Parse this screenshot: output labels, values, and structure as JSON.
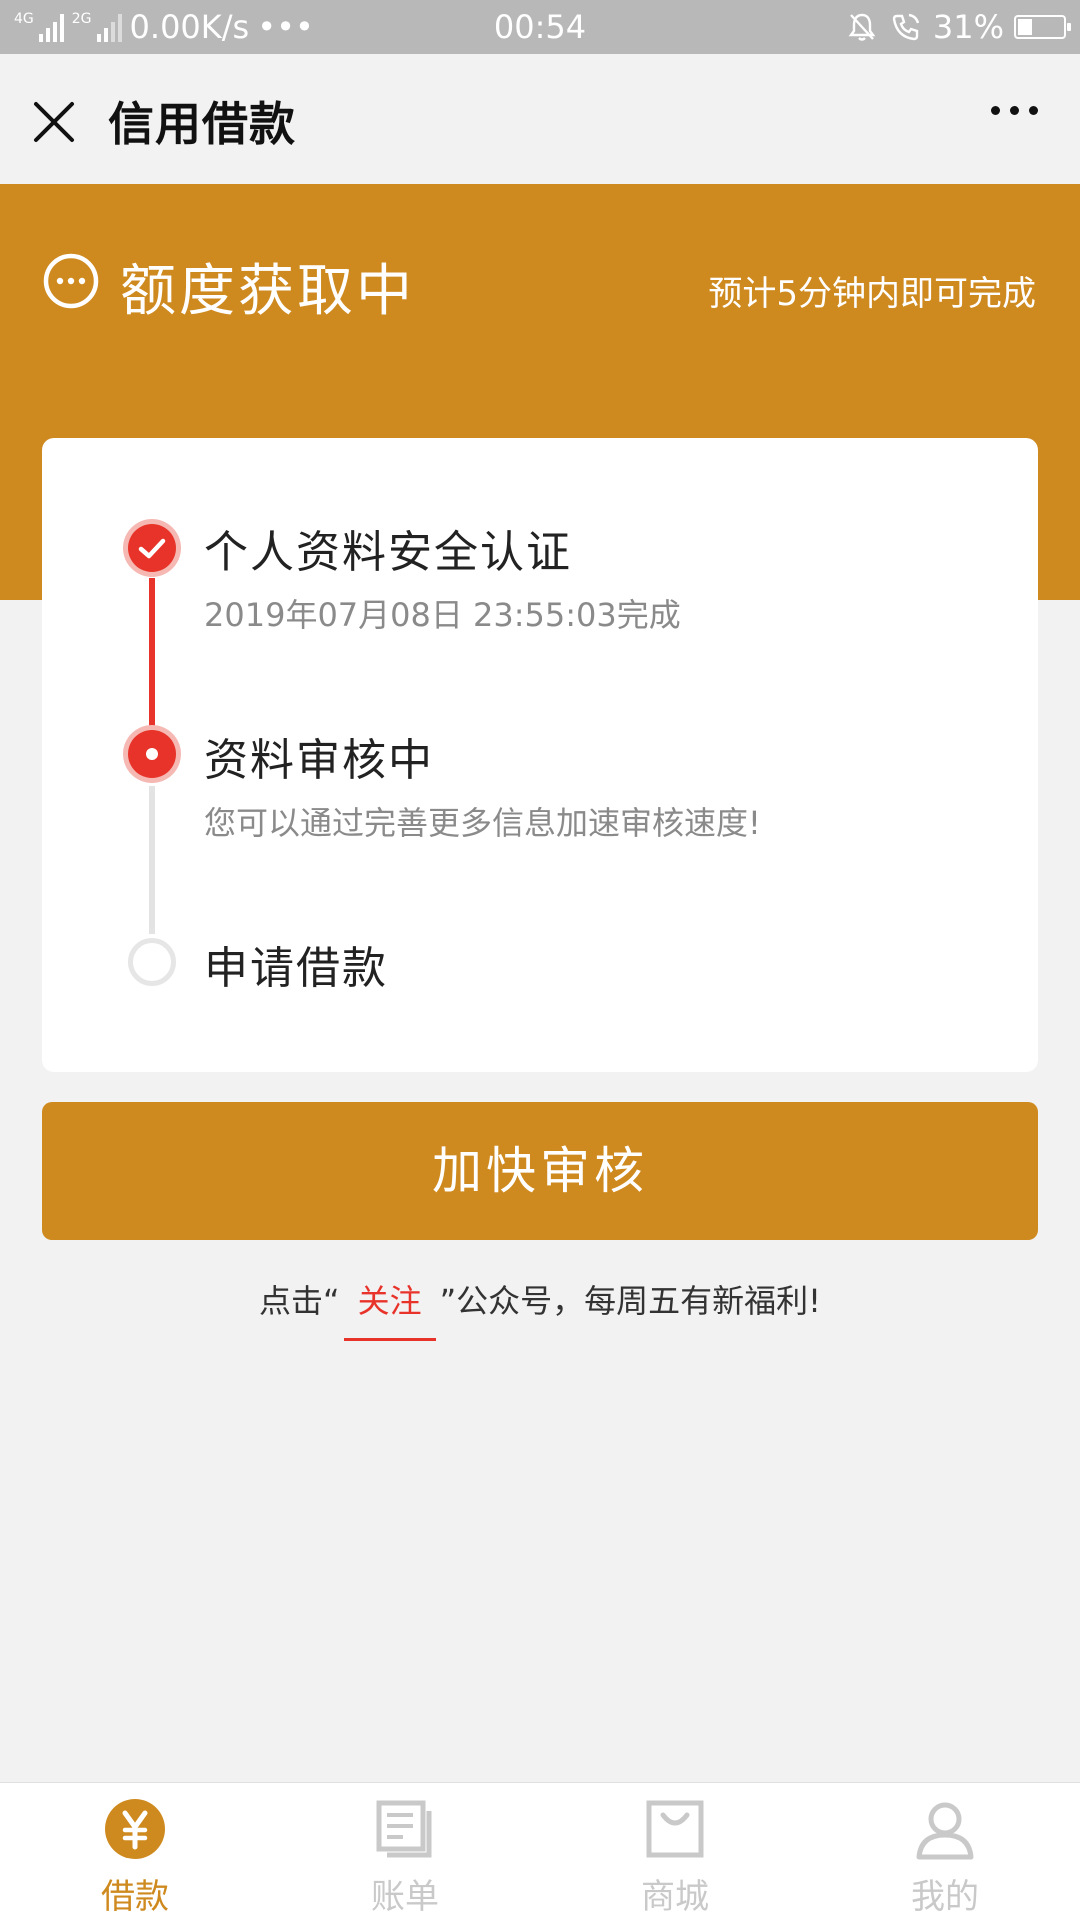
{
  "status_bar": {
    "network_label_1": "4G",
    "network_label_2": "4G",
    "network_label_3": "2G",
    "speed": "0.00K/s",
    "more": "•••",
    "time": "00:54",
    "battery_percent": "31%",
    "battery_level": 0.31
  },
  "nav": {
    "title": "信用借款"
  },
  "banner": {
    "title": "额度获取中",
    "eta": "预计5分钟内即可完成",
    "background_color": "#cf8a1f"
  },
  "steps": [
    {
      "title": "个人资料安全认证",
      "desc": "2019年07月08日 23:55:03完成",
      "state": "done"
    },
    {
      "title": "资料审核中",
      "desc": "您可以通过完善更多信息加速审核速度!",
      "state": "active"
    },
    {
      "title": "申请借款",
      "desc": "",
      "state": "pending"
    }
  ],
  "primary_button": {
    "label": "加快审核"
  },
  "footer_note": {
    "prefix": "点击“",
    "link": "关注",
    "suffix": "”公众号，每周五有新福利!"
  },
  "tabs": [
    {
      "label": "借款",
      "icon": "yen-icon",
      "active": true
    },
    {
      "label": "账单",
      "icon": "bill-icon",
      "active": false
    },
    {
      "label": "商城",
      "icon": "shop-bag-icon",
      "active": false
    },
    {
      "label": "我的",
      "icon": "user-icon",
      "active": false
    }
  ],
  "colors": {
    "accent": "#cf8a1f",
    "progress_red": "#e8332a",
    "inactive_gray": "#c9c9c9"
  }
}
